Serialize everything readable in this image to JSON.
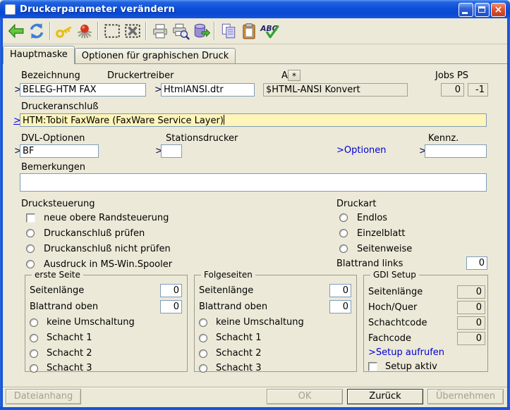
{
  "window": {
    "title": "Druckerparameter verändern"
  },
  "colors": {
    "titlebar_blue": "#0D4FD8",
    "dialog_bg": "#ECE9D8",
    "focus_field_yellow": "#FFF5B8",
    "link_blue": "#0000D4",
    "close_red": "#DD5435"
  },
  "toolbar": {
    "icons": [
      "back-icon",
      "refresh-icon",
      "key-icon",
      "seal-icon",
      "selection-box-icon",
      "selection-box-delete-icon",
      "print-icon",
      "print-preview-icon",
      "database-export-icon",
      "copy-icon",
      "paste-icon",
      "spellcheck-icon"
    ],
    "spellcheck_text": "ABC"
  },
  "tabs": [
    {
      "label": "Hauptmaske",
      "active": true
    },
    {
      "label": "Optionen für graphischen Druck",
      "active": false
    }
  ],
  "form": {
    "bezeichnung": {
      "label": "Bezeichnung",
      "prefix": ">",
      "value": "BELEG-HTM FAX"
    },
    "druckertreiber": {
      "label": "Druckertreiber",
      "prefix": ">",
      "value": "HtmlANSI.dtr"
    },
    "ansi": {
      "label": "A",
      "star_button": "*",
      "value": "$HTML-ANSI Konvert"
    },
    "jobs_ps": {
      "label": "Jobs PS",
      "jobs": "0",
      "ps": "-1"
    },
    "druckeranschluss": {
      "label": "Druckeranschluß",
      "prefix": ">",
      "value": "HTM:Tobit FaxWare (FaxWare Service Layer)"
    },
    "dvl_optionen": {
      "label": "DVL-Optionen",
      "prefix": ">",
      "value": "BF"
    },
    "stationsdrucker": {
      "label": "Stationsdrucker",
      "prefix": ">",
      "value": ""
    },
    "optionen_link": ">Optionen",
    "kennz": {
      "label": "Kennz.",
      "prefix": ">",
      "value": ""
    },
    "bemerkungen": {
      "label": "Bemerkungen",
      "value": ""
    }
  },
  "drucksteuerung": {
    "title": "Drucksteuerung",
    "checkbox": {
      "label": "neue obere Randsteuerung",
      "checked": false
    },
    "radios": [
      {
        "label": "Druckanschluß prüfen",
        "selected": false
      },
      {
        "label": "Druckanschluß nicht prüfen",
        "selected": false
      },
      {
        "label": "Ausdruck in MS-Win.Spooler",
        "selected": false
      }
    ]
  },
  "druckart": {
    "title": "Druckart",
    "radios": [
      {
        "label": "Endlos",
        "selected": false
      },
      {
        "label": "Einzelblatt",
        "selected": false
      },
      {
        "label": "Seitenweise",
        "selected": false
      }
    ],
    "blattrand_links": {
      "label": "Blattrand links",
      "value": "0"
    }
  },
  "erste_seite": {
    "title": "erste Seite",
    "seitenlaenge": {
      "label": "Seitenlänge",
      "value": "0"
    },
    "blattrand_oben": {
      "label": "Blattrand oben",
      "value": "0"
    },
    "radios": [
      {
        "label": "keine Umschaltung",
        "selected": false
      },
      {
        "label": "Schacht 1",
        "selected": false
      },
      {
        "label": "Schacht 2",
        "selected": false
      },
      {
        "label": "Schacht 3",
        "selected": false
      }
    ]
  },
  "folgeseiten": {
    "title": "Folgeseiten",
    "seitenlaenge": {
      "label": "Seitenlänge",
      "value": "0"
    },
    "blattrand_oben": {
      "label": "Blattrand oben",
      "value": "0"
    },
    "radios": [
      {
        "label": "keine Umschaltung",
        "selected": false
      },
      {
        "label": "Schacht 1",
        "selected": false
      },
      {
        "label": "Schacht 2",
        "selected": false
      },
      {
        "label": "Schacht 3",
        "selected": false
      }
    ]
  },
  "gdi_setup": {
    "title": "GDI Setup",
    "fields": [
      {
        "label": "Seitenlänge",
        "value": "0"
      },
      {
        "label": "Hoch/Quer",
        "value": "0"
      },
      {
        "label": "Schachtcode",
        "value": "0"
      },
      {
        "label": "Fachcode",
        "value": "0"
      }
    ],
    "link": ">Setup aufrufen",
    "checkbox": {
      "label": "Setup aktiv",
      "checked": false
    }
  },
  "footer": {
    "buttons": [
      {
        "label": "Dateianhang",
        "enabled": false
      },
      {
        "label": "OK",
        "enabled": false
      },
      {
        "label": "Zurück",
        "enabled": true
      },
      {
        "label": "Übernehmen",
        "enabled": false
      }
    ]
  }
}
